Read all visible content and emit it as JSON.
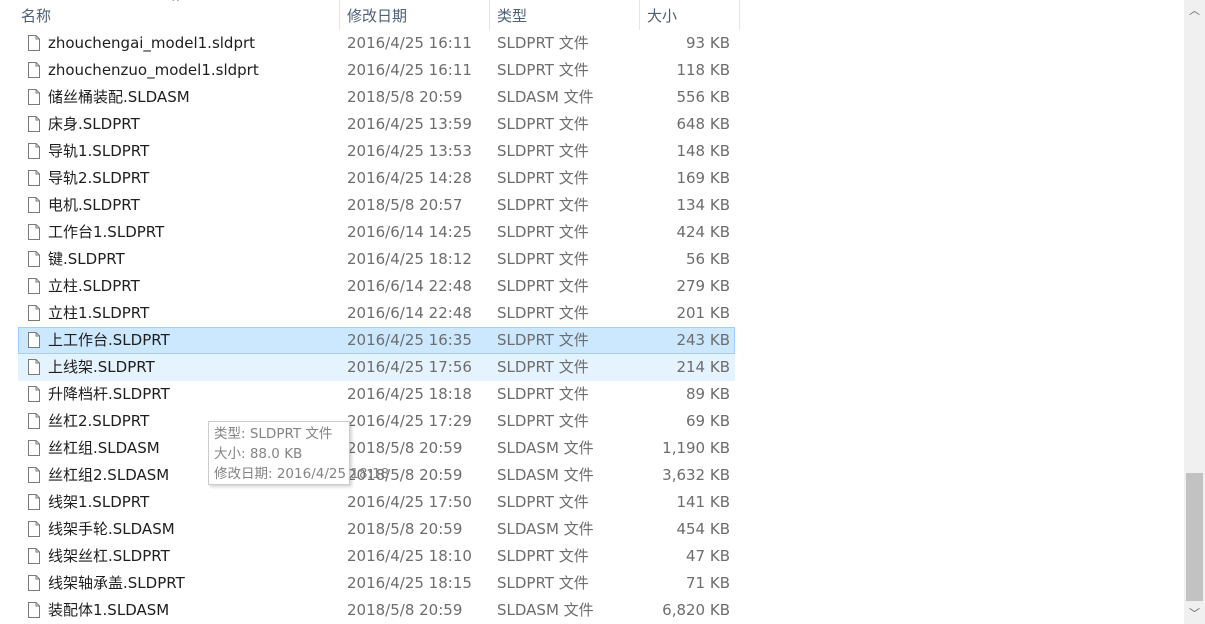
{
  "columns": {
    "name": "名称",
    "date": "修改日期",
    "type": "类型",
    "size": "大小",
    "sort_indicator": "^"
  },
  "files": [
    {
      "name": "zhouchengai_model1.sldprt",
      "date": "2016/4/25 16:11",
      "type": "SLDPRT 文件",
      "size": "93 KB"
    },
    {
      "name": "zhouchenzuo_model1.sldprt",
      "date": "2016/4/25 16:11",
      "type": "SLDPRT 文件",
      "size": "118 KB"
    },
    {
      "name": "储丝桶装配.SLDASM",
      "date": "2018/5/8 20:59",
      "type": "SLDASM 文件",
      "size": "556 KB"
    },
    {
      "name": "床身.SLDPRT",
      "date": "2016/4/25 13:59",
      "type": "SLDPRT 文件",
      "size": "648 KB"
    },
    {
      "name": "导轨1.SLDPRT",
      "date": "2016/4/25 13:53",
      "type": "SLDPRT 文件",
      "size": "148 KB"
    },
    {
      "name": "导轨2.SLDPRT",
      "date": "2016/4/25 14:28",
      "type": "SLDPRT 文件",
      "size": "169 KB"
    },
    {
      "name": "电机.SLDPRT",
      "date": "2018/5/8 20:57",
      "type": "SLDPRT 文件",
      "size": "134 KB"
    },
    {
      "name": "工作台1.SLDPRT",
      "date": "2016/6/14 14:25",
      "type": "SLDPRT 文件",
      "size": "424 KB"
    },
    {
      "name": "键.SLDPRT",
      "date": "2016/4/25 18:12",
      "type": "SLDPRT 文件",
      "size": "56 KB"
    },
    {
      "name": "立柱.SLDPRT",
      "date": "2016/6/14 22:48",
      "type": "SLDPRT 文件",
      "size": "279 KB"
    },
    {
      "name": "立柱1.SLDPRT",
      "date": "2016/6/14 22:48",
      "type": "SLDPRT 文件",
      "size": "201 KB"
    },
    {
      "name": "上工作台.SLDPRT",
      "date": "2016/4/25 16:35",
      "type": "SLDPRT 文件",
      "size": "243 KB",
      "state": "selected"
    },
    {
      "name": "上线架.SLDPRT",
      "date": "2016/4/25 17:56",
      "type": "SLDPRT 文件",
      "size": "214 KB",
      "state": "hover"
    },
    {
      "name": "升降档杆.SLDPRT",
      "date": "2016/4/25 18:18",
      "type": "SLDPRT 文件",
      "size": "89 KB"
    },
    {
      "name": "丝杠2.SLDPRT",
      "date": "2016/4/25 17:29",
      "type": "SLDPRT 文件",
      "size": "69 KB"
    },
    {
      "name": "丝杠组.SLDASM",
      "date": "2018/5/8 20:59",
      "type": "SLDASM 文件",
      "size": "1,190 KB"
    },
    {
      "name": "丝杠组2.SLDASM",
      "date": "2018/5/8 20:59",
      "type": "SLDASM 文件",
      "size": "3,632 KB"
    },
    {
      "name": "线架1.SLDPRT",
      "date": "2016/4/25 17:50",
      "type": "SLDPRT 文件",
      "size": "141 KB"
    },
    {
      "name": "线架手轮.SLDASM",
      "date": "2018/5/8 20:59",
      "type": "SLDASM 文件",
      "size": "454 KB"
    },
    {
      "name": "线架丝杠.SLDPRT",
      "date": "2016/4/25 18:10",
      "type": "SLDPRT 文件",
      "size": "47 KB"
    },
    {
      "name": "线架轴承盖.SLDPRT",
      "date": "2016/4/25 18:15",
      "type": "SLDPRT 文件",
      "size": "71 KB"
    },
    {
      "name": "装配体1.SLDASM",
      "date": "2018/5/8 20:59",
      "type": "SLDASM 文件",
      "size": "6,820 KB"
    }
  ],
  "tooltip": {
    "type_line": "类型: SLDPRT 文件",
    "size_line": "大小: 88.0 KB",
    "date_line": "修改日期: 2016/4/25 18:18"
  },
  "icons": {
    "file": "file-icon",
    "scroll_up": "chevron-up-icon",
    "scroll_down": "chevron-down-icon"
  },
  "scroll": {
    "up_glyph": "︿",
    "down_glyph": "﹀"
  },
  "colors": {
    "selected_bg": "#cce8ff",
    "selected_border": "#99d1ff",
    "hover_bg": "#e5f3ff",
    "header_text": "#4c607a",
    "secondary_text": "#6d6d6d"
  }
}
